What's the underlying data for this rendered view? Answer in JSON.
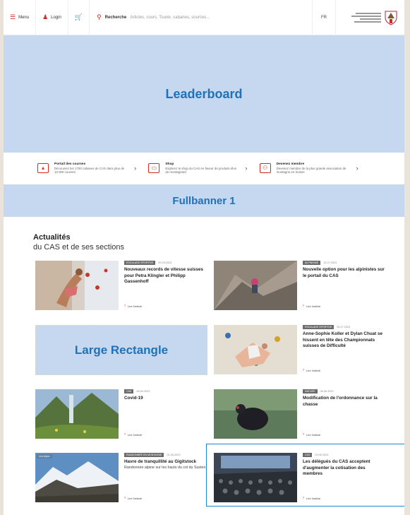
{
  "header": {
    "menu_label": "Menu",
    "login_label": "Login",
    "search_label": "Recherche",
    "search_placeholder": "Articles, cours, Tourer, cabanes, sources…",
    "language": "FR"
  },
  "ads": {
    "leaderboard": "Leaderboard",
    "fullbanner": "Fullbanner 1",
    "large_rectangle": "Large Rectangle"
  },
  "services": [
    {
      "icon": "magazine-icon",
      "title": "Portail des courses",
      "desc": "Découvrez les 1700 cabanes de CAS dans plus de 10 000 courses"
    },
    {
      "icon": "shop-icon",
      "title": "Shop",
      "desc": "Explorez le shop du CAS en faveur de produits élus du montagnard"
    },
    {
      "icon": "people-icon",
      "title": "Devenez membre",
      "desc": "Devenez membre de la plus grande association de montagne en Suisse"
    }
  ],
  "news": {
    "title": "Actualités",
    "subtitle": "du CAS et de ses sections",
    "more_label": "Lire l'article",
    "items": [
      {
        "tag": "ESCALADE SPORTIVE",
        "date": "09.09.2023",
        "title": "Nouveaux records de vitesse suisses pour Petra Klingler et Philipp Gassenhoff",
        "desc": ""
      },
      {
        "tag": "ALPINISME",
        "date": "12.07.2023",
        "title": "Nouvelle option pour les alpinistes sur le portail du CAS",
        "desc": ""
      },
      {
        "tag": "ESCALADE SPORTIVE",
        "date": "04.07.2023",
        "title": "Anne-Sophie Koller et Dylan Chuat se hissent en tête des Championnats suisses de Difficulté",
        "desc": ""
      },
      {
        "tag": "CAS",
        "date": "08.06.2023",
        "title": "Covid-19",
        "desc": ""
      },
      {
        "tag": "NATURE",
        "date": "08.06.2023",
        "title": "Modification de l'ordonnance sur la chasse",
        "desc": ""
      },
      {
        "tag": "RANDONNÉE EN MONTAGNE",
        "date": "01.06.2023",
        "title": "Havre de tranquillité au Gigitstock",
        "desc": "Randonnée alpine sur les hauts du col du Susten",
        "badge": "Les Alpes"
      },
      {
        "tag": "CAS",
        "date": "29.05.2023",
        "title": "Les délégués du CAS acceptent d'augmenter la cotisation des membres",
        "desc": ""
      }
    ]
  },
  "colors": {
    "accent": "#d52b1e",
    "ad_fill": "#c6d7f0",
    "ad_text": "#1e72b8",
    "selection": "#1e88d0"
  }
}
